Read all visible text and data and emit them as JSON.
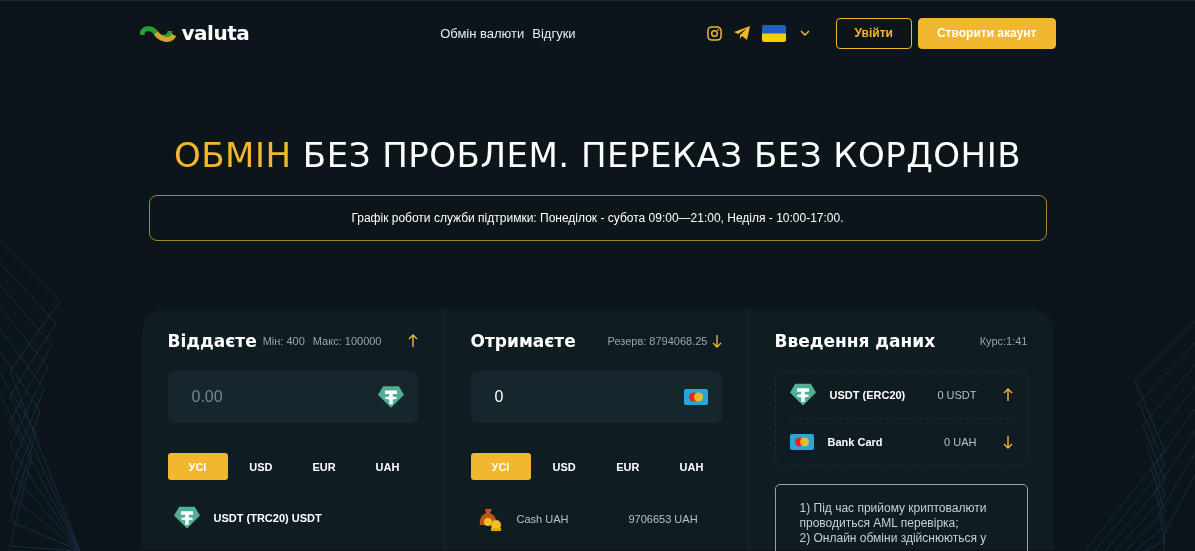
{
  "header": {
    "logo": "valuta",
    "nav": [
      "Обмін валюти",
      "Відгуки"
    ],
    "buttons": [
      {
        "label": "Увійти",
        "kind": "outline"
      },
      {
        "label": "Створити акаунт",
        "kind": "filled"
      }
    ]
  },
  "hero": {
    "highlight": "ОБМІН",
    "title": "БЕЗ ПРОБЛЕМ. ПЕРЕКАЗ БЕЗ КОРДОНІВ"
  },
  "notice": "Графік роботи служби підтримки: Понеділок - субота 09:00—21:00, Неділя - 10:00-17:00.",
  "give": {
    "title": "Віддаєте",
    "min": "Мін: 400",
    "max": "Макс: 100000",
    "amount_placeholder": "0.00",
    "tabs": [
      {
        "label": "УСІ",
        "selected": true
      },
      {
        "label": "USD",
        "selected": false
      },
      {
        "label": "EUR",
        "selected": false
      },
      {
        "label": "UAH",
        "selected": false
      }
    ],
    "items": [
      {
        "name": "USDT (TRC20) USDT"
      }
    ]
  },
  "receive": {
    "title": "Отримаєте",
    "reserve": "Резерв: 8794068.25",
    "amount": "0",
    "tabs": [
      {
        "label": "УСІ",
        "selected": true
      },
      {
        "label": "USD",
        "selected": false
      },
      {
        "label": "EUR",
        "selected": false
      },
      {
        "label": "UAH",
        "selected": false
      }
    ],
    "items": [
      {
        "name": "Cash UAH",
        "amount": "9706653 UAH"
      }
    ]
  },
  "details": {
    "title": "Введення даних",
    "rate": "Курс:1:41",
    "rows": [
      {
        "name": "USDT (ERC20)",
        "amount": "0 USDT"
      },
      {
        "name": "Bank Card",
        "amount": "0 UAH"
      }
    ],
    "notes": [
      "1) Під час прийому криптовалюти проводиться AML перевірка;",
      "2) Онлайн обміни здійснюються у"
    ]
  }
}
